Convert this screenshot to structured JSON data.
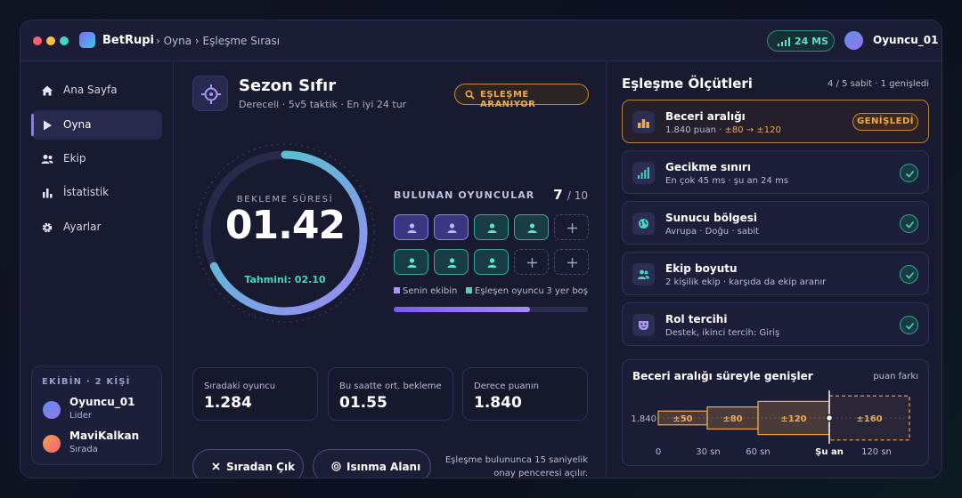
{
  "app": {
    "name": "BetRupi",
    "breadcrumb": "› Oyna › Eşleşme Sırası"
  },
  "status": {
    "ping": "24 MS",
    "user": "Oyuncu_01"
  },
  "colors": {
    "accent": "#8c7cf7",
    "teal": "#49d4bf",
    "orange": "#f0a94a",
    "dots": [
      "#ff5f6d",
      "#ffbd4a",
      "#43d6c0"
    ]
  },
  "sidebar": {
    "items": [
      {
        "label": "Ana Sayfa",
        "icon": "home-icon"
      },
      {
        "label": "Oyna",
        "icon": "play-icon",
        "active": true
      },
      {
        "label": "Ekip",
        "icon": "users-icon"
      },
      {
        "label": "İstatistik",
        "icon": "bar-chart-icon"
      },
      {
        "label": "Ayarlar",
        "icon": "gear-icon"
      }
    ],
    "team": {
      "header": "EKİBİN · 2 KİŞİ",
      "members": [
        {
          "name": "Oyuncu_01",
          "status": "Lider"
        },
        {
          "name": "MaviKalkan",
          "status": "Sırada"
        }
      ]
    }
  },
  "mode": {
    "title": "Sezon Sıfır",
    "subtitle": "Dereceli · 5v5 taktik · En iyi 24 tur",
    "searching": "EŞLEŞME ARANIYOR"
  },
  "timer": {
    "label": "BEKLEME SÜRESİ",
    "value": "01.42",
    "estimate": "Tahmini: 02.10",
    "progress": 0.68
  },
  "players": {
    "header": "BULUNAN OYUNCULAR",
    "found": "7",
    "total": "/ 10",
    "slots": [
      "own",
      "own",
      "found",
      "found",
      "empty",
      "found",
      "found",
      "found",
      "empty",
      "empty"
    ],
    "legend_own": "Senin ekibin",
    "legend_found": "Eşleşen oyuncu",
    "remaining": "3 yer boş",
    "fill": 0.7
  },
  "stats": [
    {
      "label": "Sıradaki oyuncu",
      "value": "1.284"
    },
    {
      "label": "Bu saatte ort. bekleme",
      "value": "01.55"
    },
    {
      "label": "Derece puanın",
      "value": "1.840"
    }
  ],
  "actions": {
    "leave": "Sıradan Çık",
    "warmup": "Isınma Alanı",
    "note": "Eşleşme bulununca 15 saniyelik onay penceresi açılır."
  },
  "criteria": {
    "title": "Eşleşme Ölçütleri",
    "meta": "4 / 5 sabit · 1 genişledi",
    "items": [
      {
        "name": "Beceri aralığı",
        "desc_prefix": "1.840 puan · ",
        "desc_highlight": "±80 → ±120",
        "badge": "GENİŞLEDİ",
        "icon": "skill-icon"
      },
      {
        "name": "Gecikme sınırı",
        "desc": "En çok 45 ms · şu an 24 ms",
        "icon": "signal-icon"
      },
      {
        "name": "Sunucu bölgesi",
        "desc": "Avrupa · Doğu · sabit",
        "icon": "globe-icon"
      },
      {
        "name": "Ekip boyutu",
        "desc": "2 kişilik ekip · karşıda da ekip aranır",
        "icon": "team-icon"
      },
      {
        "name": "Rol tercihi",
        "desc": "Destek, ikinci tercih: Giriş",
        "icon": "mask-icon"
      }
    ]
  },
  "chart_data": {
    "type": "area",
    "title": "Beceri aralığı süreyle genişler",
    "unit_label": "puan farkı",
    "y_label": "1.840",
    "x_ticks": [
      "0",
      "30 sn",
      "60 sn",
      "Şu an",
      "120 sn"
    ],
    "steps": [
      {
        "label": "±50",
        "range": 50
      },
      {
        "label": "±80",
        "range": 80
      },
      {
        "label": "±120",
        "range": 120
      },
      {
        "label": "±160",
        "range": 160,
        "future": true
      }
    ]
  }
}
